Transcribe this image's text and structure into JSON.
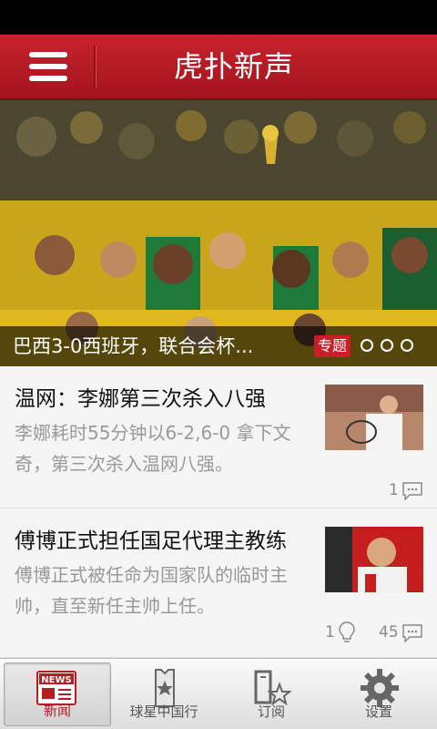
{
  "header": {
    "title": "虎扑新声",
    "menu_icon": "menu-icon"
  },
  "hero": {
    "caption": "巴西3-0西班牙，联合会杯...",
    "tag": "专题",
    "page_dots": 3,
    "active_dot": 0
  },
  "news": [
    {
      "title": "温网：李娜第三次杀入八强",
      "summary": "李娜耗时55分钟以6-2,6-0 拿下文奇，第三次杀入温网八强。",
      "comments": "1"
    },
    {
      "title": "傅博正式担任国足代理主教练",
      "summary": "傅博正式被任命为国家队的临时主帅，直至新任主帅上任。",
      "likes": "1",
      "comments": "45"
    }
  ],
  "tabs": [
    {
      "label": "新闻",
      "icon": "news-icon",
      "active": true
    },
    {
      "label": "球星中国行",
      "icon": "jersey-icon",
      "active": false
    },
    {
      "label": "订阅",
      "icon": "subscribe-icon",
      "active": false
    },
    {
      "label": "设置",
      "icon": "gear-icon",
      "active": false
    }
  ],
  "icon_text": {
    "news": "NEWS"
  },
  "colors": {
    "brand_red": "#b81c25",
    "tag_red": "#c81e28",
    "summary_grey": "#999999"
  }
}
